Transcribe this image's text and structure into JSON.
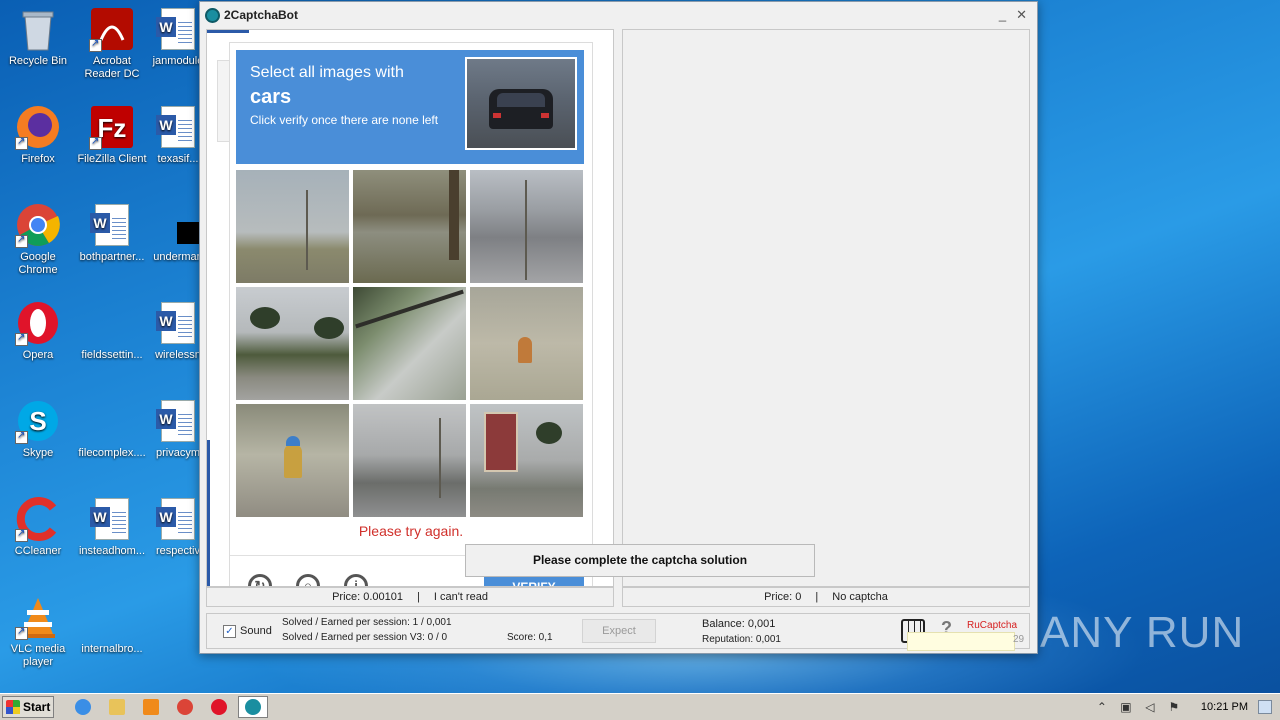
{
  "desktop": {
    "icons": [
      {
        "label": "Recycle Bin",
        "icon": "recycle-bin-icon"
      },
      {
        "label": "Acrobat Reader DC",
        "icon": "acrobat-icon"
      },
      {
        "label": "janmodule",
        "icon": "word-doc-icon"
      },
      {
        "label": "Firefox",
        "icon": "firefox-icon"
      },
      {
        "label": "FileZilla Client",
        "icon": "filezilla-icon"
      },
      {
        "label": "texasif...",
        "icon": "word-doc-icon"
      },
      {
        "label": "Google Chrome",
        "icon": "chrome-icon"
      },
      {
        "label": "bothpartner...",
        "icon": "word-doc-icon"
      },
      {
        "label": "underman",
        "icon": "black-file-icon"
      },
      {
        "label": "Opera",
        "icon": "opera-icon"
      },
      {
        "label": "fieldssettin...",
        "icon": "blank-file-icon"
      },
      {
        "label": "wirelessn",
        "icon": "word-doc-icon"
      },
      {
        "label": "Skype",
        "icon": "skype-icon"
      },
      {
        "label": "filecomplex....",
        "icon": "blank-file-icon"
      },
      {
        "label": "privacym",
        "icon": "word-doc-icon"
      },
      {
        "label": "CCleaner",
        "icon": "ccleaner-icon"
      },
      {
        "label": "insteadhom...",
        "icon": "word-doc-icon"
      },
      {
        "label": "respectiv",
        "icon": "word-doc-icon"
      },
      {
        "label": "VLC media player",
        "icon": "vlc-icon"
      },
      {
        "label": "internalbro...",
        "icon": "blank-file-icon"
      }
    ],
    "watermark": "ANY RUN"
  },
  "window": {
    "title": "2CaptchaBot",
    "minimize": "_",
    "close": "✕"
  },
  "captcha": {
    "instruction_line1": "Select all images with",
    "target_word": "cars",
    "instruction_line3": "Click verify once there are none left",
    "error_text": "Please try again.",
    "verify_label": "VERIFY",
    "reload_icon": "reload-icon",
    "audio_icon": "headphones-icon",
    "info_icon": "info-icon"
  },
  "popup": {
    "message": "Please complete the captcha solution"
  },
  "status": {
    "left_price": "Price: 0.00101",
    "left_sep": "|",
    "left_action": "I can't read",
    "right_price": "Price: 0",
    "right_sep": "|",
    "right_state": "No captcha"
  },
  "bottom": {
    "sound_label": "Sound",
    "sound_checked": "✓",
    "solved_line1": "Solved / Earned per session: 1 / 0,001",
    "solved_line2": "Solved / Earned per session V3: 0 / 0",
    "score": "Score: 0,1",
    "expect_label": "Expect",
    "balance": "Balance:  0,001",
    "reputation": "Reputation: 0,001",
    "service": "RuCaptcha",
    "version_fragment": "29"
  },
  "taskbar": {
    "start_label": "Start",
    "time": "10:21 PM",
    "tray_arrow": "⌃"
  }
}
